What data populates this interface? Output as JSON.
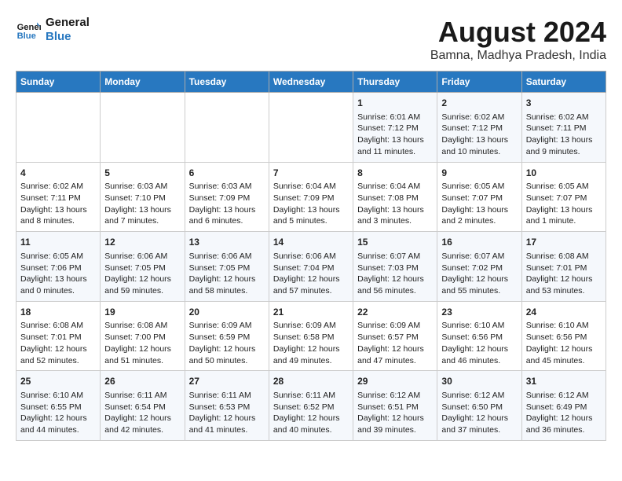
{
  "header": {
    "logo_line1": "General",
    "logo_line2": "Blue",
    "main_title": "August 2024",
    "subtitle": "Bamna, Madhya Pradesh, India"
  },
  "calendar": {
    "days_of_week": [
      "Sunday",
      "Monday",
      "Tuesday",
      "Wednesday",
      "Thursday",
      "Friday",
      "Saturday"
    ],
    "weeks": [
      [
        {
          "day": "",
          "content": ""
        },
        {
          "day": "",
          "content": ""
        },
        {
          "day": "",
          "content": ""
        },
        {
          "day": "",
          "content": ""
        },
        {
          "day": "1",
          "content": "Sunrise: 6:01 AM\nSunset: 7:12 PM\nDaylight: 13 hours\nand 11 minutes."
        },
        {
          "day": "2",
          "content": "Sunrise: 6:02 AM\nSunset: 7:12 PM\nDaylight: 13 hours\nand 10 minutes."
        },
        {
          "day": "3",
          "content": "Sunrise: 6:02 AM\nSunset: 7:11 PM\nDaylight: 13 hours\nand 9 minutes."
        }
      ],
      [
        {
          "day": "4",
          "content": "Sunrise: 6:02 AM\nSunset: 7:11 PM\nDaylight: 13 hours\nand 8 minutes."
        },
        {
          "day": "5",
          "content": "Sunrise: 6:03 AM\nSunset: 7:10 PM\nDaylight: 13 hours\nand 7 minutes."
        },
        {
          "day": "6",
          "content": "Sunrise: 6:03 AM\nSunset: 7:09 PM\nDaylight: 13 hours\nand 6 minutes."
        },
        {
          "day": "7",
          "content": "Sunrise: 6:04 AM\nSunset: 7:09 PM\nDaylight: 13 hours\nand 5 minutes."
        },
        {
          "day": "8",
          "content": "Sunrise: 6:04 AM\nSunset: 7:08 PM\nDaylight: 13 hours\nand 3 minutes."
        },
        {
          "day": "9",
          "content": "Sunrise: 6:05 AM\nSunset: 7:07 PM\nDaylight: 13 hours\nand 2 minutes."
        },
        {
          "day": "10",
          "content": "Sunrise: 6:05 AM\nSunset: 7:07 PM\nDaylight: 13 hours\nand 1 minute."
        }
      ],
      [
        {
          "day": "11",
          "content": "Sunrise: 6:05 AM\nSunset: 7:06 PM\nDaylight: 13 hours\nand 0 minutes."
        },
        {
          "day": "12",
          "content": "Sunrise: 6:06 AM\nSunset: 7:05 PM\nDaylight: 12 hours\nand 59 minutes."
        },
        {
          "day": "13",
          "content": "Sunrise: 6:06 AM\nSunset: 7:05 PM\nDaylight: 12 hours\nand 58 minutes."
        },
        {
          "day": "14",
          "content": "Sunrise: 6:06 AM\nSunset: 7:04 PM\nDaylight: 12 hours\nand 57 minutes."
        },
        {
          "day": "15",
          "content": "Sunrise: 6:07 AM\nSunset: 7:03 PM\nDaylight: 12 hours\nand 56 minutes."
        },
        {
          "day": "16",
          "content": "Sunrise: 6:07 AM\nSunset: 7:02 PM\nDaylight: 12 hours\nand 55 minutes."
        },
        {
          "day": "17",
          "content": "Sunrise: 6:08 AM\nSunset: 7:01 PM\nDaylight: 12 hours\nand 53 minutes."
        }
      ],
      [
        {
          "day": "18",
          "content": "Sunrise: 6:08 AM\nSunset: 7:01 PM\nDaylight: 12 hours\nand 52 minutes."
        },
        {
          "day": "19",
          "content": "Sunrise: 6:08 AM\nSunset: 7:00 PM\nDaylight: 12 hours\nand 51 minutes."
        },
        {
          "day": "20",
          "content": "Sunrise: 6:09 AM\nSunset: 6:59 PM\nDaylight: 12 hours\nand 50 minutes."
        },
        {
          "day": "21",
          "content": "Sunrise: 6:09 AM\nSunset: 6:58 PM\nDaylight: 12 hours\nand 49 minutes."
        },
        {
          "day": "22",
          "content": "Sunrise: 6:09 AM\nSunset: 6:57 PM\nDaylight: 12 hours\nand 47 minutes."
        },
        {
          "day": "23",
          "content": "Sunrise: 6:10 AM\nSunset: 6:56 PM\nDaylight: 12 hours\nand 46 minutes."
        },
        {
          "day": "24",
          "content": "Sunrise: 6:10 AM\nSunset: 6:56 PM\nDaylight: 12 hours\nand 45 minutes."
        }
      ],
      [
        {
          "day": "25",
          "content": "Sunrise: 6:10 AM\nSunset: 6:55 PM\nDaylight: 12 hours\nand 44 minutes."
        },
        {
          "day": "26",
          "content": "Sunrise: 6:11 AM\nSunset: 6:54 PM\nDaylight: 12 hours\nand 42 minutes."
        },
        {
          "day": "27",
          "content": "Sunrise: 6:11 AM\nSunset: 6:53 PM\nDaylight: 12 hours\nand 41 minutes."
        },
        {
          "day": "28",
          "content": "Sunrise: 6:11 AM\nSunset: 6:52 PM\nDaylight: 12 hours\nand 40 minutes."
        },
        {
          "day": "29",
          "content": "Sunrise: 6:12 AM\nSunset: 6:51 PM\nDaylight: 12 hours\nand 39 minutes."
        },
        {
          "day": "30",
          "content": "Sunrise: 6:12 AM\nSunset: 6:50 PM\nDaylight: 12 hours\nand 37 minutes."
        },
        {
          "day": "31",
          "content": "Sunrise: 6:12 AM\nSunset: 6:49 PM\nDaylight: 12 hours\nand 36 minutes."
        }
      ]
    ]
  }
}
